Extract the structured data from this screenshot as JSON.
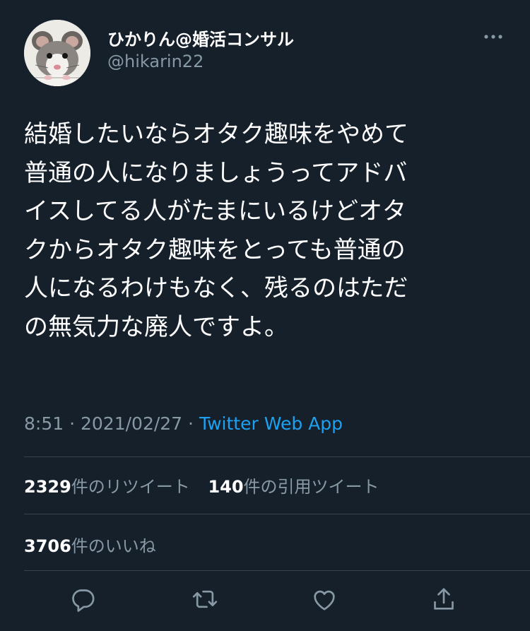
{
  "author": {
    "display_name": "ひかりん@婚活コンサル",
    "handle": "@hikarin22",
    "avatar_icon": "rat-avatar"
  },
  "tweet": {
    "lines": [
      "結婚したいならオタク趣味をやめて",
      "普通の人になりましょうってアドバ",
      "イスしてる人がたまにいるけどオタ",
      "クからオタク趣味をとっても普通の",
      "人になるわけもなく、残るのはただ",
      "の無気力な廃人ですよ。"
    ],
    "time": "8:51",
    "separator": "·",
    "date": "2021/02/27",
    "source": "Twitter Web App"
  },
  "stats": {
    "retweets": {
      "count": "2329",
      "label": "件のリツイート"
    },
    "quotes": {
      "count": "140",
      "label": "件の引用ツイート"
    },
    "likes": {
      "count": "3706",
      "label": "件のいいね"
    }
  },
  "actions": [
    "reply-icon",
    "retweet-icon",
    "like-icon",
    "share-icon"
  ],
  "colors": {
    "background": "#15202b",
    "text": "#ffffff",
    "secondary": "#8899a6",
    "accent": "#1da1f2",
    "divider": "#38444d"
  }
}
